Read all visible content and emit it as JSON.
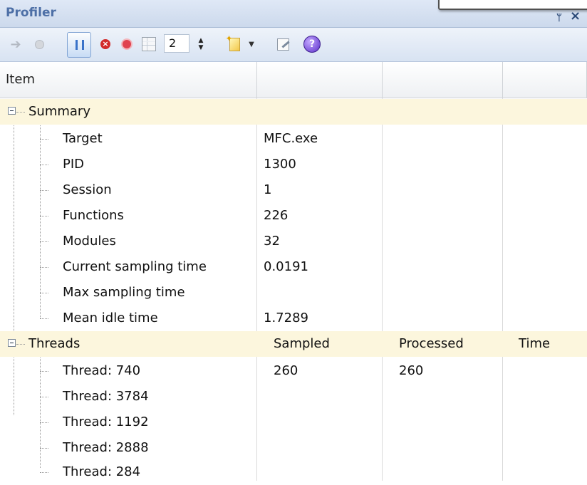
{
  "window": {
    "title": "Profiler"
  },
  "toolbar": {
    "depth_value": "2"
  },
  "columns": {
    "item": "Item",
    "col2": "",
    "col3": "",
    "col4": ""
  },
  "summary": {
    "label": "Summary",
    "rows": [
      {
        "name": "Target",
        "value": "MFC.exe"
      },
      {
        "name": "PID",
        "value": "1300"
      },
      {
        "name": "Session",
        "value": "1"
      },
      {
        "name": "Functions",
        "value": "226"
      },
      {
        "name": "Modules",
        "value": "32"
      },
      {
        "name": "Current sampling time",
        "value": "0.0191"
      },
      {
        "name": "Max sampling time",
        "value": ""
      },
      {
        "name": "Mean idle time",
        "value": "1.7289"
      }
    ]
  },
  "threads": {
    "label": "Threads",
    "col_sampled": "Sampled",
    "col_processed": "Processed",
    "col_time": "Time",
    "rows": [
      {
        "name": "Thread: 740",
        "sampled": "260",
        "processed": "260",
        "time": ""
      },
      {
        "name": "Thread: 3784",
        "sampled": "",
        "processed": "",
        "time": ""
      },
      {
        "name": "Thread: 1192",
        "sampled": "",
        "processed": "",
        "time": ""
      },
      {
        "name": "Thread: 2888",
        "sampled": "",
        "processed": "",
        "time": ""
      },
      {
        "name": "Thread: 284",
        "sampled": "",
        "processed": "",
        "time": ""
      }
    ]
  }
}
